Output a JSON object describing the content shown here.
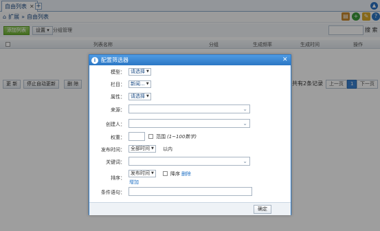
{
  "tab": {
    "title": "自由列表",
    "close": "✕",
    "add": "+"
  },
  "crumbs": [
    "扩展",
    "自由列表"
  ],
  "crumb_sep": "»",
  "toolbar": {
    "add_label": "添加列表",
    "settings_label": "设置",
    "group_label": "分组管理",
    "search_label": "搜 索"
  },
  "grid": {
    "columns": [
      "列表名称",
      "分组",
      "生成频率",
      "生成时间",
      "操作"
    ]
  },
  "actions": {
    "refresh": "更 新",
    "stop_auto": "停止自动更新",
    "delete": "删 除"
  },
  "pager": {
    "info": "共有2条记录",
    "prev": "上一页",
    "page": "1",
    "next": "下一页"
  },
  "dialog": {
    "title": "配置筛选器",
    "close": "✕",
    "labels": {
      "model": "模型：",
      "column": "栏目：",
      "attr": "属性：",
      "source": "来源：",
      "creator": "创建人：",
      "weight": "权重：",
      "pubtime": "发布时间：",
      "keyword": "关键词：",
      "sort": "排序：",
      "condition": "条件语句："
    },
    "model_value": "请选择",
    "column_value": "新闻...",
    "attr_value": "请选择",
    "range_label": "范围",
    "range_hint": "(1~100数字)",
    "pubtime_value": "全部时间",
    "pubtime_suffix": "以内",
    "sort_value": "发布时间",
    "desc_label": "降序",
    "delete_link": "删除",
    "add_link": "增加",
    "ok": "确定"
  },
  "colors": {
    "accent": "#2a76c4",
    "tabbar": "#eef3f8",
    "overlay": "rgba(0,0,0,0.38)"
  }
}
